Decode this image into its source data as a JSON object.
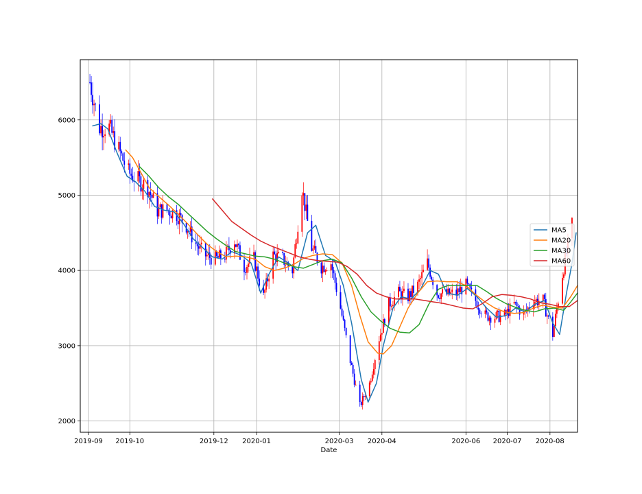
{
  "chart_data": {
    "type": "line",
    "title": "",
    "xlabel": "Date",
    "ylabel": "",
    "x_ticks": [
      "2019-09",
      "2019-10",
      "2019-12",
      "2020-01",
      "2020-03",
      "2020-04",
      "2020-06",
      "2020-07",
      "2020-08"
    ],
    "y_ticks": [
      2000,
      3000,
      4000,
      5000,
      6000
    ],
    "xlim": [
      "2019-08-26",
      "2020-08-21"
    ],
    "ylim": [
      1850,
      6800
    ],
    "grid": true,
    "legend_position": "center-right",
    "candlestick": {
      "up_color": "#ff0000",
      "down_color": "#0000ff",
      "note_series": "price candles"
    },
    "close_points": [
      [
        "2019-09-02",
        6500
      ],
      [
        "2019-09-09",
        5900
      ],
      [
        "2019-09-16",
        5900
      ],
      [
        "2019-09-23",
        5600
      ],
      [
        "2019-09-30",
        5300
      ],
      [
        "2019-10-07",
        5200
      ],
      [
        "2019-10-14",
        5100
      ],
      [
        "2019-10-21",
        4800
      ],
      [
        "2019-10-28",
        4800
      ],
      [
        "2019-11-04",
        4750
      ],
      [
        "2019-11-11",
        4600
      ],
      [
        "2019-11-18",
        4350
      ],
      [
        "2019-11-25",
        4200
      ],
      [
        "2019-12-02",
        4150
      ],
      [
        "2019-12-09",
        4200
      ],
      [
        "2019-12-16",
        4400
      ],
      [
        "2019-12-23",
        4050
      ],
      [
        "2019-12-30",
        4150
      ],
      [
        "2020-01-06",
        3650
      ],
      [
        "2020-01-13",
        4200
      ],
      [
        "2020-01-20",
        4150
      ],
      [
        "2020-01-27",
        4000
      ],
      [
        "2020-02-03",
        5100
      ],
      [
        "2020-02-10",
        4300
      ],
      [
        "2020-02-17",
        4050
      ],
      [
        "2020-02-24",
        4100
      ],
      [
        "2020-03-02",
        3500
      ],
      [
        "2020-03-09",
        2800
      ],
      [
        "2020-03-16",
        2200
      ],
      [
        "2020-03-23",
        2500
      ],
      [
        "2020-03-30",
        3100
      ],
      [
        "2020-04-06",
        3550
      ],
      [
        "2020-04-13",
        3700
      ],
      [
        "2020-04-20",
        3650
      ],
      [
        "2020-04-27",
        3800
      ],
      [
        "2020-05-04",
        4100
      ],
      [
        "2020-05-11",
        3700
      ],
      [
        "2020-05-18",
        3680
      ],
      [
        "2020-05-25",
        3700
      ],
      [
        "2020-06-01",
        3800
      ],
      [
        "2020-06-08",
        3600
      ],
      [
        "2020-06-15",
        3400
      ],
      [
        "2020-06-22",
        3380
      ],
      [
        "2020-06-29",
        3400
      ],
      [
        "2020-07-06",
        3550
      ],
      [
        "2020-07-13",
        3420
      ],
      [
        "2020-07-20",
        3600
      ],
      [
        "2020-07-27",
        3600
      ],
      [
        "2020-08-03",
        3150
      ],
      [
        "2020-08-10",
        3950
      ],
      [
        "2020-08-17",
        4600
      ]
    ],
    "series": [
      {
        "name": "MA5",
        "color": "#1f77b4",
        "points": [
          [
            "2019-09-04",
            5920
          ],
          [
            "2019-09-10",
            5950
          ],
          [
            "2019-09-15",
            5880
          ],
          [
            "2019-09-22",
            5550
          ],
          [
            "2019-09-29",
            5250
          ],
          [
            "2019-10-05",
            5180
          ],
          [
            "2019-10-12",
            5050
          ],
          [
            "2019-10-19",
            4850
          ],
          [
            "2019-10-26",
            4800
          ],
          [
            "2019-11-02",
            4780
          ],
          [
            "2019-11-09",
            4620
          ],
          [
            "2019-11-16",
            4420
          ],
          [
            "2019-11-23",
            4300
          ],
          [
            "2019-11-30",
            4180
          ],
          [
            "2019-12-07",
            4150
          ],
          [
            "2019-12-14",
            4250
          ],
          [
            "2019-12-21",
            4200
          ],
          [
            "2019-12-28",
            4100
          ],
          [
            "2020-01-04",
            3700
          ],
          [
            "2020-01-10",
            3950
          ],
          [
            "2020-01-17",
            4180
          ],
          [
            "2020-01-24",
            4100
          ],
          [
            "2020-01-31",
            4000
          ],
          [
            "2020-02-07",
            4500
          ],
          [
            "2020-02-13",
            4600
          ],
          [
            "2020-02-20",
            4200
          ],
          [
            "2020-02-27",
            4120
          ],
          [
            "2020-03-04",
            3800
          ],
          [
            "2020-03-10",
            3300
          ],
          [
            "2020-03-17",
            2550
          ],
          [
            "2020-03-22",
            2250
          ],
          [
            "2020-03-28",
            2500
          ],
          [
            "2020-04-02",
            3000
          ],
          [
            "2020-04-09",
            3500
          ],
          [
            "2020-04-15",
            3650
          ],
          [
            "2020-04-22",
            3620
          ],
          [
            "2020-04-29",
            3750
          ],
          [
            "2020-05-06",
            4000
          ],
          [
            "2020-05-12",
            3950
          ],
          [
            "2020-05-18",
            3700
          ],
          [
            "2020-05-26",
            3670
          ],
          [
            "2020-06-02",
            3760
          ],
          [
            "2020-06-09",
            3650
          ],
          [
            "2020-06-16",
            3500
          ],
          [
            "2020-06-23",
            3380
          ],
          [
            "2020-06-30",
            3400
          ],
          [
            "2020-07-07",
            3500
          ],
          [
            "2020-07-14",
            3450
          ],
          [
            "2020-07-21",
            3550
          ],
          [
            "2020-07-28",
            3600
          ],
          [
            "2020-08-03",
            3300
          ],
          [
            "2020-08-08",
            3150
          ],
          [
            "2020-08-13",
            3700
          ],
          [
            "2020-08-17",
            4100
          ],
          [
            "2020-08-20",
            4500
          ]
        ]
      },
      {
        "name": "MA20",
        "color": "#ff7f0e",
        "points": [
          [
            "2019-09-28",
            5600
          ],
          [
            "2019-10-03",
            5500
          ],
          [
            "2019-10-09",
            5300
          ],
          [
            "2019-10-15",
            5100
          ],
          [
            "2019-10-22",
            4980
          ],
          [
            "2019-10-29",
            4870
          ],
          [
            "2019-11-05",
            4750
          ],
          [
            "2019-11-12",
            4620
          ],
          [
            "2019-11-19",
            4480
          ],
          [
            "2019-11-26",
            4350
          ],
          [
            "2019-12-03",
            4250
          ],
          [
            "2019-12-10",
            4180
          ],
          [
            "2019-12-17",
            4190
          ],
          [
            "2019-12-24",
            4180
          ],
          [
            "2019-12-31",
            4150
          ],
          [
            "2020-01-07",
            4050
          ],
          [
            "2020-01-14",
            4000
          ],
          [
            "2020-01-21",
            4030
          ],
          [
            "2020-01-28",
            4080
          ],
          [
            "2020-02-04",
            4160
          ],
          [
            "2020-02-11",
            4200
          ],
          [
            "2020-02-18",
            4220
          ],
          [
            "2020-02-25",
            4210
          ],
          [
            "2020-03-03",
            4100
          ],
          [
            "2020-03-10",
            3800
          ],
          [
            "2020-03-16",
            3400
          ],
          [
            "2020-03-22",
            3050
          ],
          [
            "2020-03-29",
            2900
          ],
          [
            "2020-04-02",
            2890
          ],
          [
            "2020-04-08",
            3000
          ],
          [
            "2020-04-14",
            3250
          ],
          [
            "2020-04-20",
            3500
          ],
          [
            "2020-04-27",
            3700
          ],
          [
            "2020-05-04",
            3850
          ],
          [
            "2020-05-11",
            3860
          ],
          [
            "2020-05-18",
            3850
          ],
          [
            "2020-05-25",
            3850
          ],
          [
            "2020-06-01",
            3800
          ],
          [
            "2020-06-08",
            3680
          ],
          [
            "2020-06-15",
            3580
          ],
          [
            "2020-06-22",
            3500
          ],
          [
            "2020-06-29",
            3450
          ],
          [
            "2020-07-06",
            3430
          ],
          [
            "2020-07-13",
            3440
          ],
          [
            "2020-07-20",
            3500
          ],
          [
            "2020-07-27",
            3540
          ],
          [
            "2020-08-03",
            3510
          ],
          [
            "2020-08-10",
            3500
          ],
          [
            "2020-08-16",
            3650
          ],
          [
            "2020-08-21",
            3800
          ]
        ]
      },
      {
        "name": "MA30",
        "color": "#2ca02c",
        "points": [
          [
            "2019-10-08",
            5380
          ],
          [
            "2019-10-15",
            5250
          ],
          [
            "2019-10-22",
            5100
          ],
          [
            "2019-10-29",
            4980
          ],
          [
            "2019-11-05",
            4880
          ],
          [
            "2019-11-12",
            4760
          ],
          [
            "2019-11-19",
            4640
          ],
          [
            "2019-11-26",
            4520
          ],
          [
            "2019-12-03",
            4420
          ],
          [
            "2019-12-10",
            4330
          ],
          [
            "2019-12-17",
            4250
          ],
          [
            "2019-12-24",
            4220
          ],
          [
            "2019-12-31",
            4190
          ],
          [
            "2020-01-07",
            4180
          ],
          [
            "2020-01-14",
            4150
          ],
          [
            "2020-01-21",
            4100
          ],
          [
            "2020-01-28",
            4050
          ],
          [
            "2020-02-04",
            4030
          ],
          [
            "2020-02-11",
            4080
          ],
          [
            "2020-02-18",
            4130
          ],
          [
            "2020-02-25",
            4150
          ],
          [
            "2020-03-03",
            4100
          ],
          [
            "2020-03-10",
            3900
          ],
          [
            "2020-03-17",
            3650
          ],
          [
            "2020-03-24",
            3450
          ],
          [
            "2020-03-31",
            3330
          ],
          [
            "2020-04-07",
            3230
          ],
          [
            "2020-04-14",
            3180
          ],
          [
            "2020-04-21",
            3170
          ],
          [
            "2020-04-28",
            3280
          ],
          [
            "2020-05-05",
            3550
          ],
          [
            "2020-05-12",
            3750
          ],
          [
            "2020-05-19",
            3800
          ],
          [
            "2020-05-26",
            3800
          ],
          [
            "2020-06-02",
            3800
          ],
          [
            "2020-06-09",
            3800
          ],
          [
            "2020-06-16",
            3720
          ],
          [
            "2020-06-23",
            3630
          ],
          [
            "2020-06-30",
            3560
          ],
          [
            "2020-07-07",
            3510
          ],
          [
            "2020-07-14",
            3470
          ],
          [
            "2020-07-21",
            3450
          ],
          [
            "2020-07-28",
            3490
          ],
          [
            "2020-08-04",
            3500
          ],
          [
            "2020-08-11",
            3470
          ],
          [
            "2020-08-16",
            3580
          ],
          [
            "2020-08-21",
            3700
          ]
        ]
      },
      {
        "name": "MA60",
        "color": "#d62728",
        "points": [
          [
            "2019-11-30",
            4950
          ],
          [
            "2019-12-07",
            4800
          ],
          [
            "2019-12-14",
            4650
          ],
          [
            "2019-12-21",
            4560
          ],
          [
            "2019-12-28",
            4470
          ],
          [
            "2020-01-04",
            4390
          ],
          [
            "2020-01-11",
            4330
          ],
          [
            "2020-01-18",
            4280
          ],
          [
            "2020-01-25",
            4230
          ],
          [
            "2020-02-01",
            4180
          ],
          [
            "2020-02-08",
            4150
          ],
          [
            "2020-02-15",
            4130
          ],
          [
            "2020-02-22",
            4120
          ],
          [
            "2020-02-29",
            4110
          ],
          [
            "2020-03-07",
            4050
          ],
          [
            "2020-03-14",
            3950
          ],
          [
            "2020-03-21",
            3800
          ],
          [
            "2020-03-28",
            3700
          ],
          [
            "2020-04-04",
            3650
          ],
          [
            "2020-04-11",
            3620
          ],
          [
            "2020-04-18",
            3620
          ],
          [
            "2020-04-25",
            3620
          ],
          [
            "2020-05-02",
            3600
          ],
          [
            "2020-05-09",
            3580
          ],
          [
            "2020-05-16",
            3560
          ],
          [
            "2020-05-23",
            3530
          ],
          [
            "2020-05-30",
            3500
          ],
          [
            "2020-06-06",
            3490
          ],
          [
            "2020-06-13",
            3560
          ],
          [
            "2020-06-20",
            3650
          ],
          [
            "2020-06-27",
            3680
          ],
          [
            "2020-07-04",
            3670
          ],
          [
            "2020-07-11",
            3650
          ],
          [
            "2020-07-18",
            3620
          ],
          [
            "2020-07-25",
            3570
          ],
          [
            "2020-08-01",
            3550
          ],
          [
            "2020-08-08",
            3520
          ],
          [
            "2020-08-15",
            3520
          ],
          [
            "2020-08-21",
            3600
          ]
        ]
      }
    ]
  }
}
